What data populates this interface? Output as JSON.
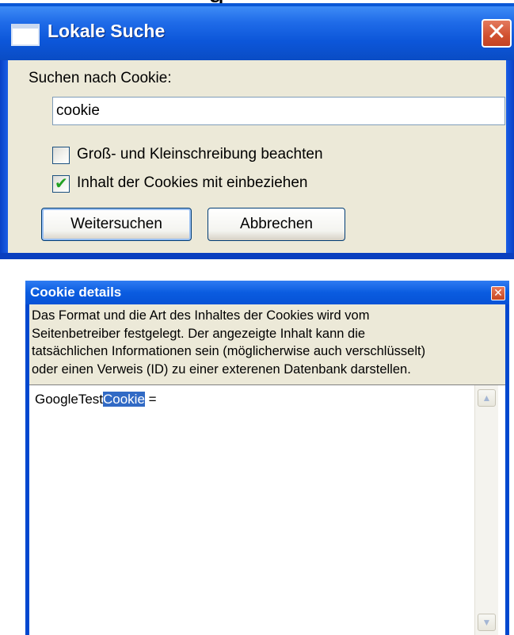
{
  "cut_text": "g",
  "search_dialog": {
    "title": "Lokale Suche",
    "search_label": "Suchen nach Cookie:",
    "search_value": "cookie",
    "options": [
      {
        "label": "Groß- und Kleinschreibung beachten",
        "checked": false
      },
      {
        "label": "Inhalt der Cookies mit einbeziehen",
        "checked": true
      }
    ],
    "buttons": {
      "find_next": "Weitersuchen",
      "cancel": "Abbrechen"
    },
    "close_glyph": "✕"
  },
  "cookie_details": {
    "title": "Cookie details",
    "description_lines": [
      "Das Format und die Art des Inhaltes der Cookies wird vom",
      "Seitenbetreiber festgelegt. Der angezeigte Inhalt kann die",
      "tatsächlichen Informationen sein (möglicherwise auch verschlüsselt)",
      "oder einen Verweis (ID) zu einer exterenen Datenbank darstellen."
    ],
    "content_prefix": "GoogleTest",
    "content_highlight": "Cookie",
    "content_suffix": " =",
    "close_glyph": "✕",
    "highlight_color": "#316ac5"
  },
  "icons": {
    "scroll_up": "up-arrow-icon",
    "scroll_down": "down-arrow-icon",
    "close": "close-icon",
    "app": "window-icon",
    "check": "checkmark-icon"
  }
}
